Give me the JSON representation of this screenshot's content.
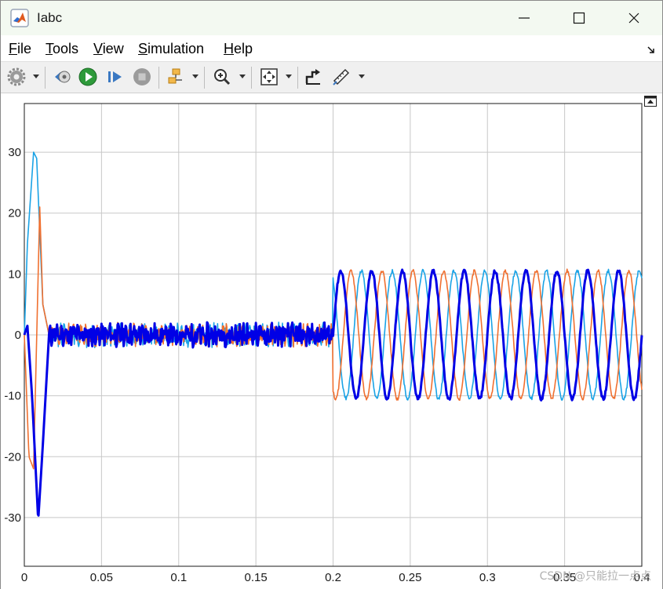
{
  "window": {
    "title": "Iabc"
  },
  "menu": {
    "file": {
      "accel": "F",
      "rest": "ile"
    },
    "tools": {
      "accel": "T",
      "rest": "ools"
    },
    "view": {
      "accel": "V",
      "rest": "iew"
    },
    "simulation": {
      "accel": "S",
      "rest": "imulation"
    },
    "help": {
      "accel": "H",
      "rest": "elp"
    }
  },
  "toolbar": {
    "icons": [
      "gear-icon",
      "step-back-icon",
      "run-icon",
      "step-forward-icon",
      "stop-icon",
      "highlight-block-icon",
      "zoom-icon",
      "fit-to-view-icon",
      "signal-select-icon",
      "measure-icon"
    ]
  },
  "watermark": "CSDN @只能拉一点点",
  "colors": {
    "phase_a": "#0000e6",
    "phase_b": "#f07030",
    "phase_c": "#1aa3e6",
    "grid": "#c8c8c8",
    "axes": "#1a1a1a"
  },
  "chart_data": {
    "type": "line",
    "title": "",
    "xlabel": "",
    "ylabel": "",
    "xlim": [
      0,
      0.4
    ],
    "ylim": [
      -38,
      38
    ],
    "xticks": [
      "0",
      "0.05",
      "0.1",
      "0.15",
      "0.2",
      "0.25",
      "0.3",
      "0.35",
      "0.4"
    ],
    "yticks": [
      "30",
      "20",
      "10",
      "0",
      "-10",
      "-20",
      "-30"
    ],
    "grid": true,
    "legend": "none",
    "series": [
      {
        "color": "#0000e6",
        "line_width": "thick",
        "startup": {
          "t": [
            0,
            0.002,
            0.005,
            0.009,
            0.012,
            0.016
          ],
          "value": [
            0,
            1.5,
            -10,
            -30.5,
            -18,
            0
          ]
        },
        "steady_noise_band": [
          -1.5,
          1.5
        ],
        "step_time": 0.2,
        "amplitude_after_step": 10.5,
        "frequency_hz": 50,
        "phase_deg": 0
      },
      {
        "color": "#f07030",
        "line_width": "thin",
        "startup": {
          "t": [
            0,
            0.003,
            0.006,
            0.01,
            0.012,
            0.016
          ],
          "value": [
            0,
            -20,
            -22,
            21,
            5,
            0
          ]
        },
        "steady_noise_band": [
          -1.5,
          1.5
        ],
        "step_time": 0.2,
        "amplitude_after_step": 10.5,
        "frequency_hz": 50,
        "phase_deg": -120
      },
      {
        "color": "#1aa3e6",
        "line_width": "thin",
        "startup": {
          "t": [
            0,
            0.002,
            0.006,
            0.008,
            0.012,
            0.016
          ],
          "value": [
            0,
            15,
            30,
            29,
            5,
            0
          ]
        },
        "steady_noise_band": [
          -1.5,
          1.5
        ],
        "step_time": 0.2,
        "amplitude_after_step": 10.5,
        "frequency_hz": 50,
        "phase_deg": 120
      }
    ]
  }
}
